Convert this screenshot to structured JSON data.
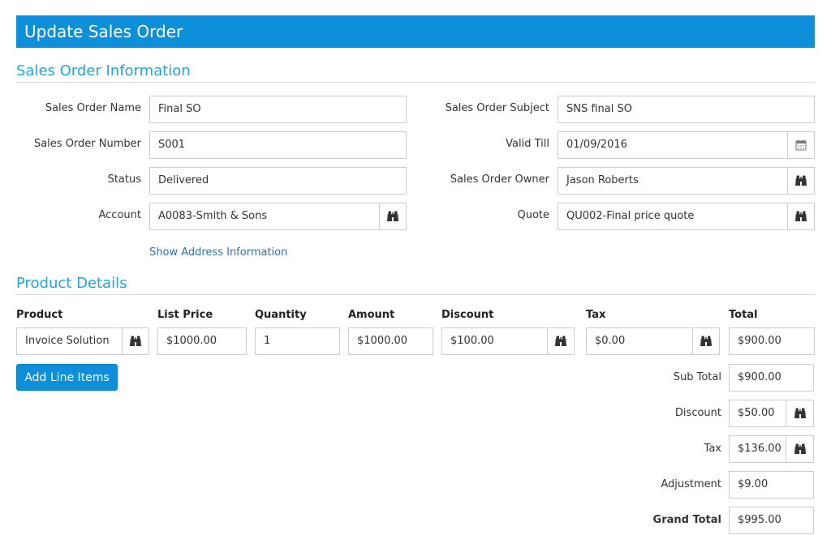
{
  "page": {
    "title": "Update Sales Order"
  },
  "sections": {
    "info_title": "Sales Order Information",
    "product_title": "Product Details"
  },
  "left_fields": {
    "name_label": "Sales Order Name",
    "name_value": "Final SO",
    "number_label": "Sales Order Number",
    "number_value": "S001",
    "status_label": "Status",
    "status_value": "Delivered",
    "account_label": "Account",
    "account_value": "A0083-Smith & Sons"
  },
  "right_fields": {
    "subject_label": "Sales Order Subject",
    "subject_value": "SNS final SO",
    "valid_label": "Valid Till",
    "valid_value": "01/09/2016",
    "owner_label": "Sales Order Owner",
    "owner_value": "Jason Roberts",
    "quote_label": "Quote",
    "quote_value": "QU002-Final price quote"
  },
  "address_link": "Show Address Information",
  "product_table": {
    "headers": {
      "product": "Product",
      "list_price": "List Price",
      "quantity": "Quantity",
      "amount": "Amount",
      "discount": "Discount",
      "tax": "Tax",
      "total": "Total"
    },
    "row": {
      "product": "Invoice Solution",
      "list_price": "$1000.00",
      "quantity": "1",
      "amount": "$1000.00",
      "discount": "$100.00",
      "tax": "$0.00",
      "total": "$900.00"
    }
  },
  "add_line_items": "Add Line Items",
  "summary": {
    "subtotal_label": "Sub Total",
    "subtotal_value": "$900.00",
    "discount_label": "Discount",
    "discount_value": "$50.00",
    "tax_label": "Tax",
    "tax_value": "$136.00",
    "adjustment_label": "Adjustment",
    "adjustment_value": "$9.00",
    "grand_label": "Grand Total",
    "grand_value": "$995.00"
  },
  "icons": {
    "lookup": "binoculars-icon",
    "calendar": "calendar-icon"
  },
  "colors": {
    "header_bg": "#0d8fd9",
    "section_title": "#22a4dd",
    "link": "#2f6fae"
  }
}
